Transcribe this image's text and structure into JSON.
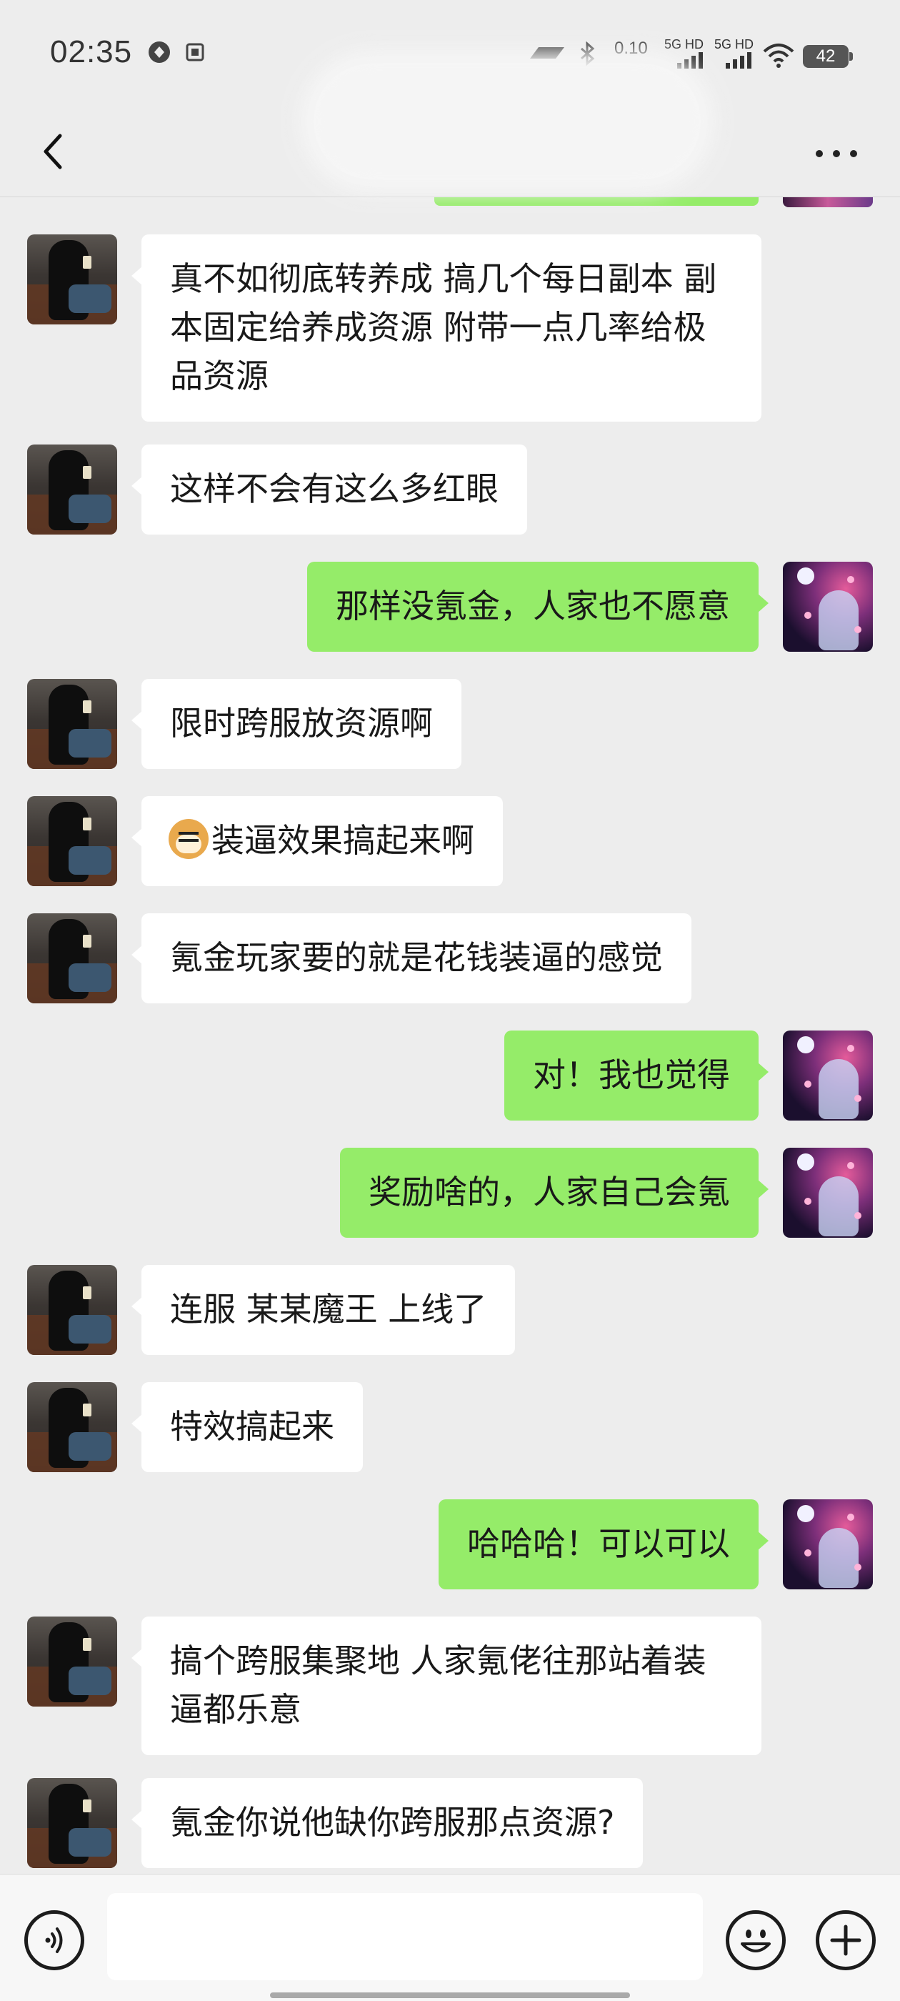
{
  "status_bar": {
    "time": "02:35",
    "speed": "0.10",
    "signal1": "5G HD",
    "signal2": "5G HD",
    "battery": "42"
  },
  "header": {
    "back_icon": "chevron-left-icon",
    "more_icon": "ellipsis-icon"
  },
  "messages": [
    {
      "side": "left",
      "text": "真不如彻底转养成 搞几个每日副本 副本固定给养成资源 附带一点几率给极品资源"
    },
    {
      "side": "left",
      "text": "这样不会有这么多红眼"
    },
    {
      "side": "right",
      "text": "那样没氪金，人家也不愿意"
    },
    {
      "side": "left",
      "text": "限时跨服放资源啊"
    },
    {
      "side": "left",
      "text": "装逼效果搞起来啊",
      "emoji": "doge-emoji"
    },
    {
      "side": "left",
      "text": "氪金玩家要的就是花钱装逼的感觉"
    },
    {
      "side": "right",
      "text": "对！我也觉得"
    },
    {
      "side": "right",
      "text": "奖励啥的，人家自己会氪"
    },
    {
      "side": "left",
      "text": "连服 某某魔王 上线了"
    },
    {
      "side": "left",
      "text": "特效搞起来"
    },
    {
      "side": "right",
      "text": "哈哈哈！可以可以"
    },
    {
      "side": "left",
      "text": "搞个跨服集聚地 人家氪佬往那站着装逼都乐意"
    },
    {
      "side": "left",
      "text": "氪金你说他缺你跨服那点资源?"
    }
  ],
  "input_bar": {
    "voice_icon": "voice-icon",
    "emoji_icon": "emoji-smile-icon",
    "plus_icon": "plus-icon",
    "input_value": ""
  },
  "colors": {
    "background": "#ededed",
    "bubble_self": "#95ec69",
    "bubble_other": "#ffffff"
  }
}
